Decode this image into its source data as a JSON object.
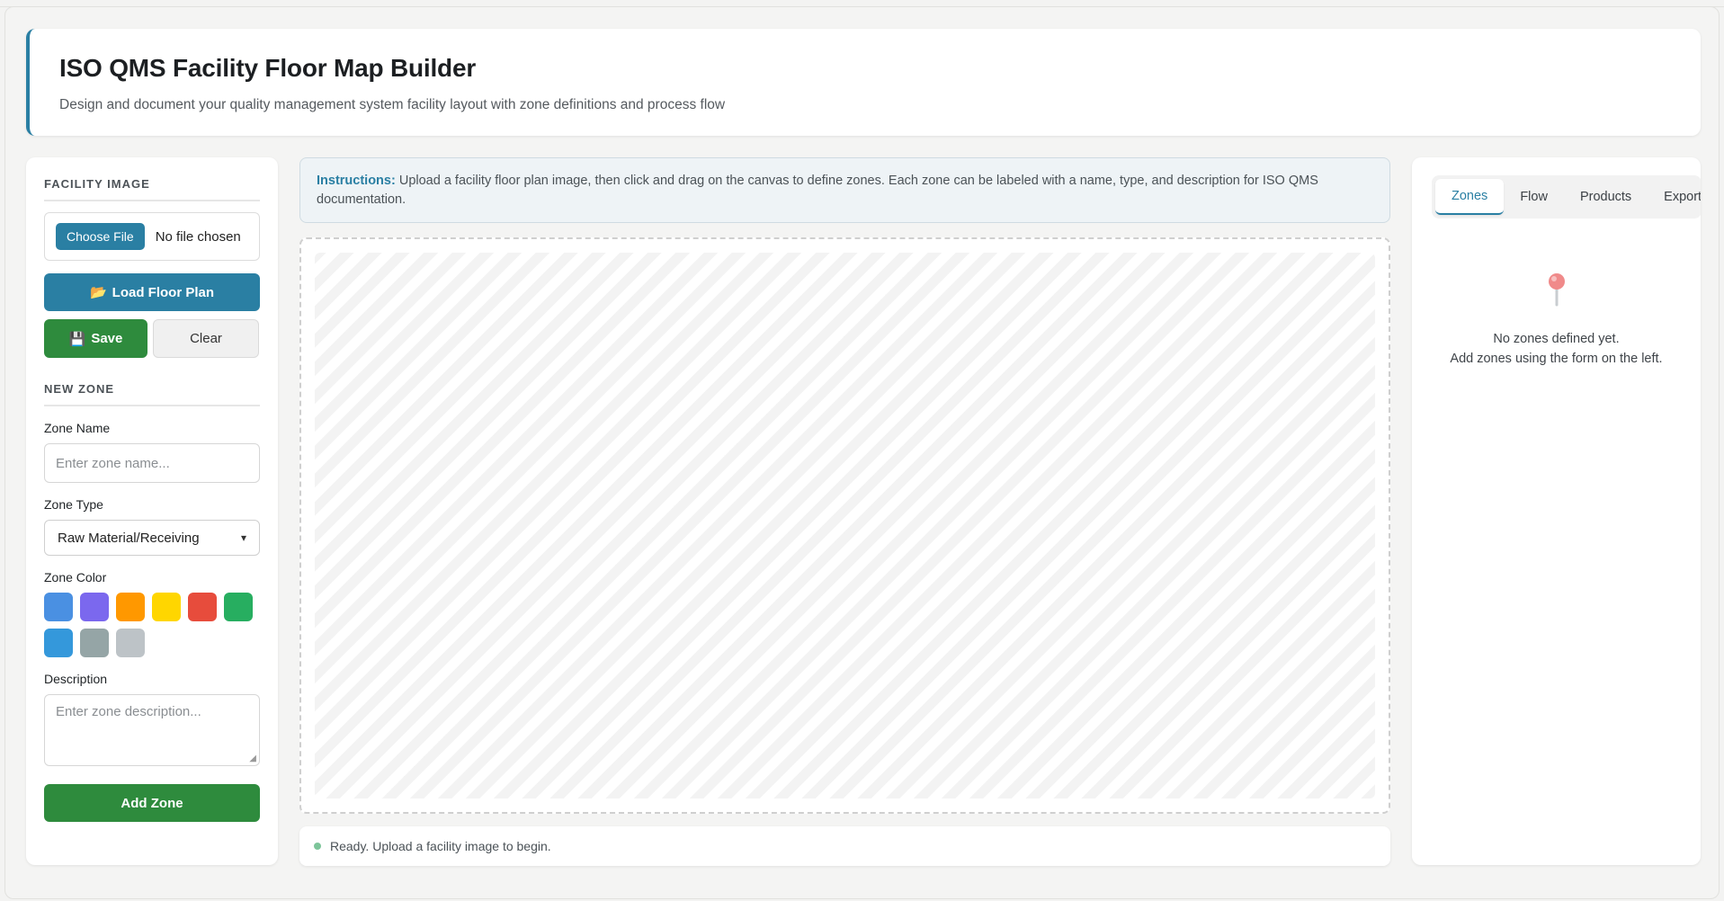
{
  "header": {
    "title": "ISO QMS Facility Floor Map Builder",
    "subtitle": "Design and document your quality management system facility layout with zone definitions and process flow"
  },
  "left": {
    "facility_title": "FACILITY IMAGE",
    "choose_file": "Choose File",
    "no_file": "No file chosen",
    "load_label": "Load Floor Plan",
    "save_label": "Save",
    "clear_label": "Clear",
    "new_zone_title": "NEW ZONE",
    "zone_name_label": "Zone Name",
    "zone_name_placeholder": "Enter zone name...",
    "zone_type_label": "Zone Type",
    "zone_type_value": "Raw Material/Receiving",
    "zone_color_label": "Zone Color",
    "colors": [
      "#4a90e2",
      "#7b68ee",
      "#ff9800",
      "#ffd600",
      "#e74c3c",
      "#27ae60",
      "#3498db",
      "#95a5a6",
      "#bdc3c7"
    ],
    "description_label": "Description",
    "description_placeholder": "Enter zone description...",
    "add_zone_label": "Add Zone"
  },
  "instructions": {
    "label": "Instructions:",
    "text": " Upload a facility floor plan image, then click and drag on the canvas to define zones. Each zone can be labeled with a name, type, and description for ISO QMS documentation."
  },
  "status": {
    "text": "Ready. Upload a facility image to begin."
  },
  "right": {
    "tabs": [
      "Zones",
      "Flow",
      "Products",
      "Export"
    ],
    "empty_line1": "No zones defined yet.",
    "empty_line2": "Add zones using the form on the left."
  }
}
